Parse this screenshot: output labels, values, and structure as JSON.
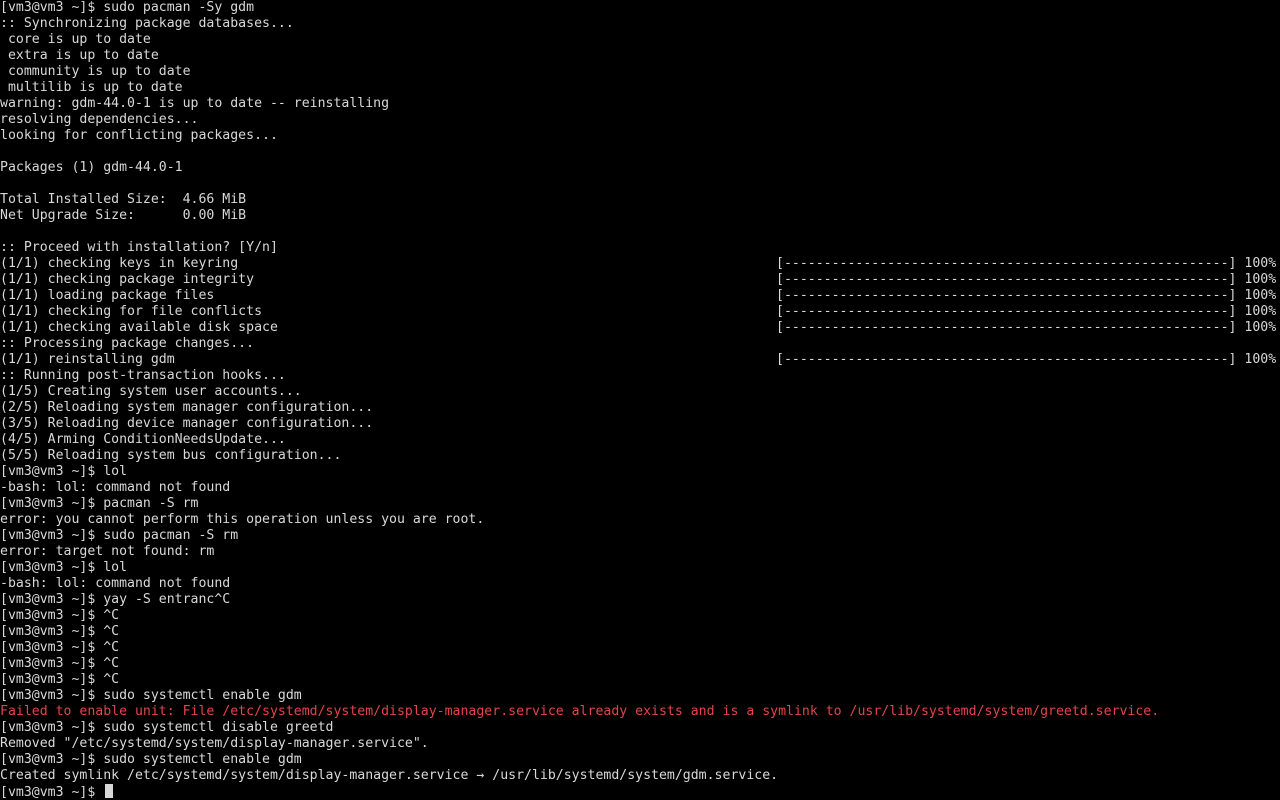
{
  "colors": {
    "background": "#000000",
    "text": "#d8d8d8",
    "error": "#e0454a"
  },
  "progress_bar": "[--------------------------------------------------------] 100%",
  "lines": [
    "[vm3@vm3 ~]$ sudo pacman -Sy gdm",
    ":: Synchronizing package databases...",
    " core is up to date",
    " extra is up to date",
    " community is up to date",
    " multilib is up to date",
    "warning: gdm-44.0-1 is up to date -- reinstalling",
    "resolving dependencies...",
    "looking for conflicting packages...",
    "",
    "Packages (1) gdm-44.0-1",
    "",
    "Total Installed Size:  4.66 MiB",
    "Net Upgrade Size:      0.00 MiB",
    "",
    ":: Proceed with installation? [Y/n]",
    "(1/1) checking keys in keyring",
    "(1/1) checking package integrity",
    "(1/1) loading package files",
    "(1/1) checking for file conflicts",
    "(1/1) checking available disk space",
    ":: Processing package changes...",
    "(1/1) reinstalling gdm",
    ":: Running post-transaction hooks...",
    "(1/5) Creating system user accounts...",
    "(2/5) Reloading system manager configuration...",
    "(3/5) Reloading device manager configuration...",
    "(4/5) Arming ConditionNeedsUpdate...",
    "(5/5) Reloading system bus configuration...",
    "[vm3@vm3 ~]$ lol",
    "-bash: lol: command not found",
    "[vm3@vm3 ~]$ pacman -S rm",
    "error: you cannot perform this operation unless you are root.",
    "[vm3@vm3 ~]$ sudo pacman -S rm",
    "error: target not found: rm",
    "[vm3@vm3 ~]$ lol",
    "-bash: lol: command not found",
    "[vm3@vm3 ~]$ yay -S entranc^C",
    "[vm3@vm3 ~]$ ^C",
    "[vm3@vm3 ~]$ ^C",
    "[vm3@vm3 ~]$ ^C",
    "[vm3@vm3 ~]$ ^C",
    "[vm3@vm3 ~]$ ^C",
    "[vm3@vm3 ~]$ sudo systemctl enable gdm",
    "Failed to enable unit: File /etc/systemd/system/display-manager.service already exists and is a symlink to /usr/lib/systemd/system/greetd.service.",
    "[vm3@vm3 ~]$ sudo systemctl disable greetd",
    "Removed \"/etc/systemd/system/display-manager.service\".",
    "[vm3@vm3 ~]$ sudo systemctl enable gdm",
    "Created symlink /etc/systemd/system/display-manager.service → /usr/lib/systemd/system/gdm.service.",
    "[vm3@vm3 ~]$ "
  ]
}
